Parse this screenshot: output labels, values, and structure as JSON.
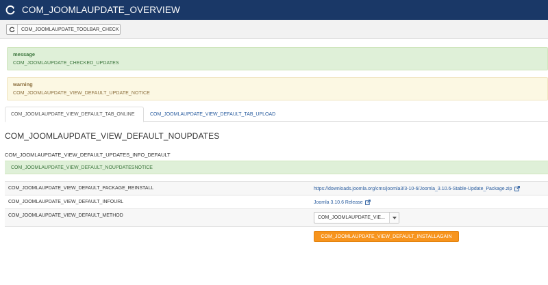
{
  "header": {
    "title": "COM_JOOMLAUPDATE_OVERVIEW",
    "icon": "refresh-icon"
  },
  "toolbar": {
    "check_label": "COM_JOOMLAUPDATE_TOOLBAR_CHECK",
    "icon": "refresh-icon"
  },
  "messages": {
    "success": {
      "heading": "message",
      "text": "COM_JOOMLAUPDATE_CHECKED_UPDATES"
    },
    "warning": {
      "heading": "warning",
      "text": "COM_JOOMLAUPDATE_VIEW_DEFAULT_UPDATE_NOTICE"
    }
  },
  "tabs": [
    {
      "label": "COM_JOOMLAUPDATE_VIEW_DEFAULT_TAB_ONLINE",
      "active": true
    },
    {
      "label": "COM_JOOMLAUPDATE_VIEW_DEFAULT_TAB_UPLOAD",
      "active": false
    }
  ],
  "main": {
    "title": "COM_JOOMLAUPDATE_VIEW_DEFAULT_NOUPDATES",
    "info_default": "COM_JOOMLAUPDATE_VIEW_DEFAULT_UPDATES_INFO_DEFAULT",
    "notice": "COM_JOOMLAUPDATE_VIEW_DEFAULT_NOUPDATESNOTICE"
  },
  "table": {
    "rows": [
      {
        "label": "COM_JOOMLAUPDATE_VIEW_DEFAULT_PACKAGE_REINSTALL",
        "value": "https://downloads.joomla.org/cms/joomla3/3-10-6/Joomla_3.10.6-Stable-Update_Package.zip"
      },
      {
        "label": "COM_JOOMLAUPDATE_VIEW_DEFAULT_INFOURL",
        "value": "Joomla 3.10.6 Release"
      },
      {
        "label": "COM_JOOMLAUPDATE_VIEW_DEFAULT_METHOD",
        "value": "COM_JOOMLAUPDATE_VIE..."
      }
    ]
  },
  "install_button": "COM_JOOMLAUPDATE_VIEW_DEFAULT_INSTALLAGAIN",
  "colors": {
    "header_bg": "#1a3867",
    "success_bg": "#dff0d8",
    "warning_bg": "#fcf8e3",
    "link": "#2a5d9f",
    "install_button": "#f7941d"
  }
}
